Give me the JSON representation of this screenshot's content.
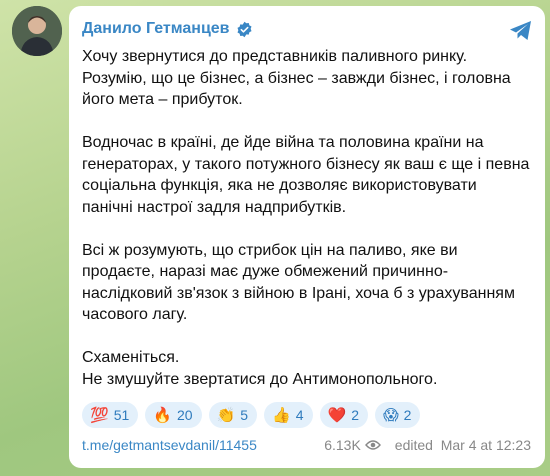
{
  "post": {
    "author": "Данило Гетманцев",
    "paragraphs": [
      "Хочу звернутися до представників паливного ринку. Розумію, що це бізнес, а бізнес – завжди бізнес, і головна його мета – прибуток.",
      "Водночас в країні, де йде війна та половина країни на генераторах, у такого потужного бізнесу як ваш є ще і певна соціальна функція, яка не дозволяє використовувати панічні настрої задля надприбутків.",
      "Всі ж розумують, що стрибок цін на паливо, яке ви продаєте, наразі має дуже обмежений причинно-наслідковий зв'язок з війною в Ірані, хоча б з урахуванням часового лагу.",
      "Схаменіться.",
      "Не змушуйте звертатися до Антимонопольного."
    ],
    "reactions": [
      {
        "emoji": "💯",
        "count": "51"
      },
      {
        "emoji": "🔥",
        "count": "20"
      },
      {
        "emoji": "👏",
        "count": "5"
      },
      {
        "emoji": "👍",
        "count": "4"
      },
      {
        "emoji": "❤️",
        "count": "2"
      },
      {
        "emoji": "😱",
        "count": "2"
      }
    ],
    "link": "t.me/getmantsevdanil/11455",
    "views": "6.13K",
    "edited": "edited  Mar 4 at 12:23"
  },
  "icons": {
    "avatar": "avatar",
    "verified": "verified-badge-icon",
    "share": "telegram-share-icon",
    "eye": "eye-icon"
  },
  "colors": {
    "accent": "#3a87c5",
    "reaction_bg": "#e3f0fb",
    "chat_bg": "#b6d38f"
  }
}
